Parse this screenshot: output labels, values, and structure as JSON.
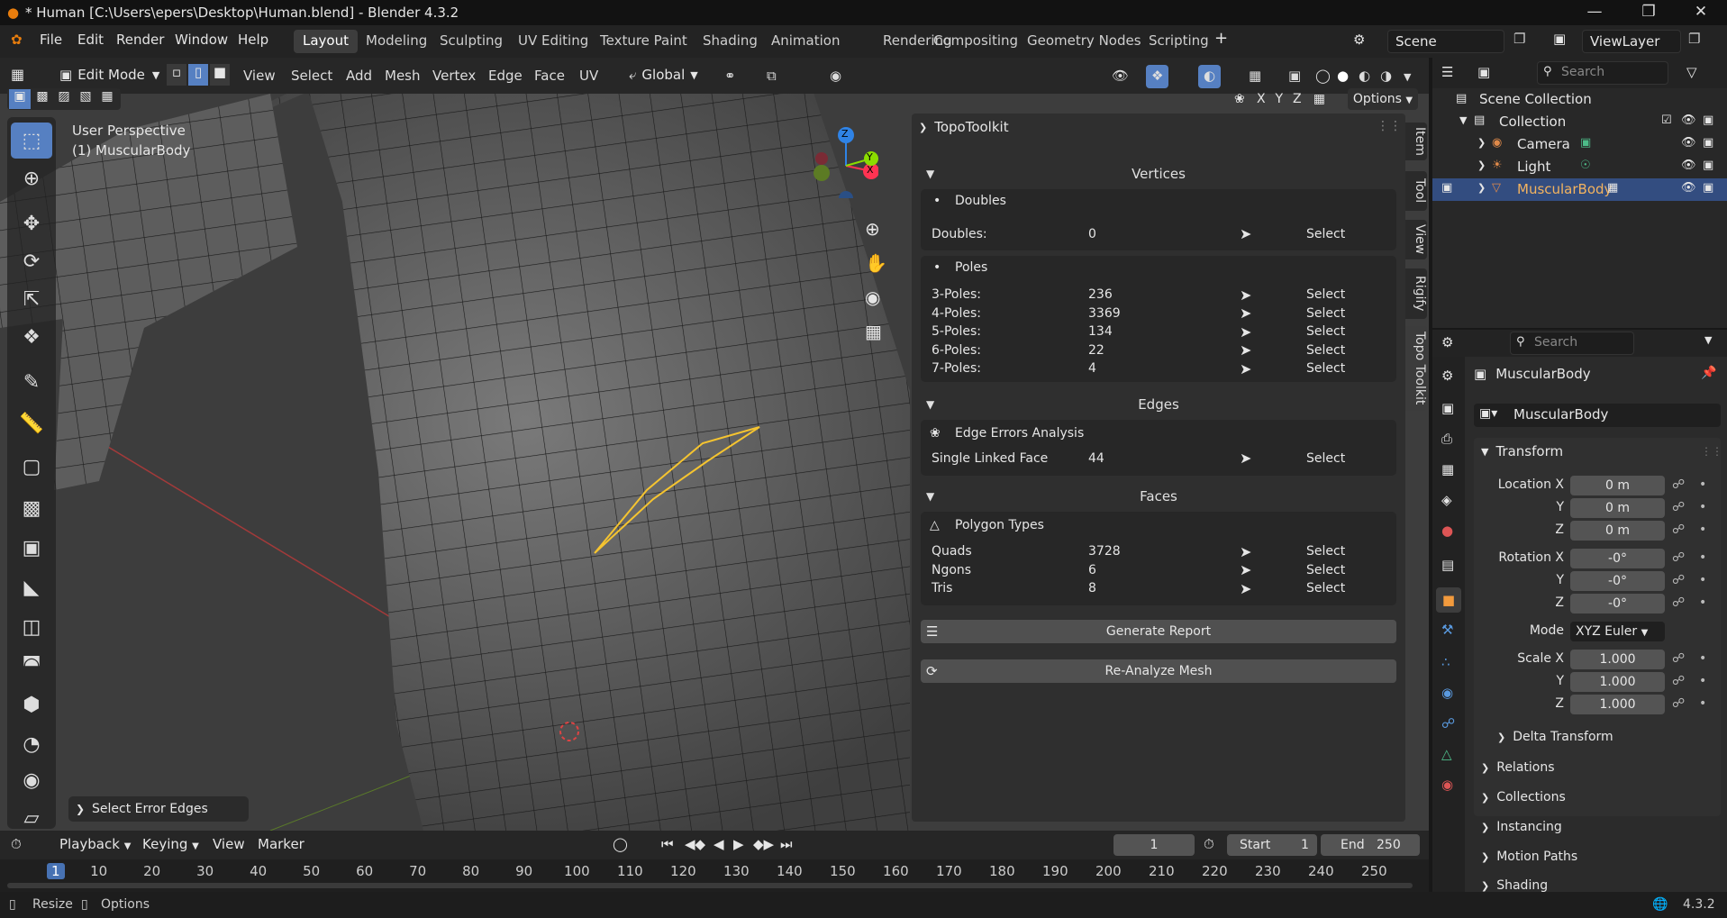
{
  "window": {
    "title": "* Human [C:\\Users\\epers\\Desktop\\Human.blend] - Blender 4.3.2",
    "minimize": "—",
    "maximize": "❐",
    "close": "✕"
  },
  "menu": {
    "file": "File",
    "edit": "Edit",
    "render": "Render",
    "window": "Window",
    "help": "Help"
  },
  "workspaces": [
    "Layout",
    "Modeling",
    "Sculpting",
    "UV Editing",
    "Texture Paint",
    "Shading",
    "Animation",
    "Rendering",
    "Compositing",
    "Geometry Nodes",
    "Scripting"
  ],
  "workspace_add": "+",
  "scene": {
    "name": "Scene",
    "view_layer": "ViewLayer"
  },
  "header3d": {
    "mode": "Edit Mode",
    "menus": [
      "View",
      "Select",
      "Add",
      "Mesh",
      "Vertex",
      "Edge",
      "Face",
      "UV"
    ],
    "orientation": "Global",
    "options": "Options",
    "axes": [
      "X",
      "Y",
      "Z"
    ]
  },
  "viewport": {
    "perspective": "User Perspective",
    "object": "(1) MuscularBody",
    "last_op": "Select Error Edges"
  },
  "gizmo": {
    "x": "X",
    "y": "Y",
    "z": "Z"
  },
  "topo": {
    "title": "TopoToolkit",
    "vertices_header": "Vertices",
    "doubles_box": "Doubles",
    "doubles": {
      "label": "Doubles:",
      "value": "0"
    },
    "poles_box": "Poles",
    "poles": [
      {
        "label": "3-Poles:",
        "value": "236"
      },
      {
        "label": "4-Poles:",
        "value": "3369"
      },
      {
        "label": "5-Poles:",
        "value": "134"
      },
      {
        "label": "6-Poles:",
        "value": "22"
      },
      {
        "label": "7-Poles:",
        "value": "4"
      }
    ],
    "edges_header": "Edges",
    "edge_box": "Edge Errors Analysis",
    "single_linked": {
      "label": "Single Linked Face",
      "value": "44"
    },
    "faces_header": "Faces",
    "poly_box": "Polygon Types",
    "polys": [
      {
        "label": "Quads",
        "value": "3728"
      },
      {
        "label": "Ngons",
        "value": "6"
      },
      {
        "label": "Tris",
        "value": "8"
      }
    ],
    "select": "Select",
    "generate": "Generate Report",
    "reanalyze": "Re-Analyze Mesh"
  },
  "ntabs": [
    "Item",
    "Tool",
    "View",
    "Rigify",
    "Topo Toolkit"
  ],
  "outliner": {
    "search_placeholder": "Search",
    "scene_collection": "Scene Collection",
    "collection": "Collection",
    "items": [
      "Camera",
      "Light",
      "MuscularBody"
    ]
  },
  "properties": {
    "search_placeholder": "Search",
    "object_name": "MuscularBody",
    "data_name": "MuscularBody",
    "transform": "Transform",
    "location_x_label": "Location X",
    "location_x": "0 m",
    "location_y_label": "Y",
    "location_y": "0 m",
    "location_z_label": "Z",
    "location_z": "0 m",
    "rotation_x_label": "Rotation X",
    "rotation_x": "-0°",
    "rotation_y_label": "Y",
    "rotation_y": "-0°",
    "rotation_z_label": "Z",
    "rotation_z": "-0°",
    "mode_label": "Mode",
    "mode": "XYZ Euler",
    "scale_x_label": "Scale X",
    "scale_x": "1.000",
    "scale_y_label": "Y",
    "scale_y": "1.000",
    "scale_z_label": "Z",
    "scale_z": "1.000",
    "delta": "Delta Transform",
    "panels": [
      "Relations",
      "Collections",
      "Instancing",
      "Motion Paths",
      "Shading"
    ]
  },
  "timeline": {
    "menus": [
      "Playback",
      "Keying",
      "View",
      "Marker"
    ],
    "current": "1",
    "start_label": "Start",
    "start": "1",
    "end_label": "End",
    "end": "250",
    "ticks": [
      "1",
      "10",
      "20",
      "30",
      "40",
      "50",
      "60",
      "70",
      "80",
      "90",
      "100",
      "110",
      "120",
      "130",
      "140",
      "150",
      "160",
      "170",
      "180",
      "190",
      "200",
      "210",
      "220",
      "230",
      "240",
      "250"
    ]
  },
  "status": {
    "resize": "Resize",
    "options": "Options",
    "version": "4.3.2"
  },
  "colors": {
    "accent": "#5680c2",
    "selected": "#f5c430",
    "x_axis": "#ff3352",
    "y_axis": "#8bdc00",
    "z_axis": "#2f83e6"
  }
}
